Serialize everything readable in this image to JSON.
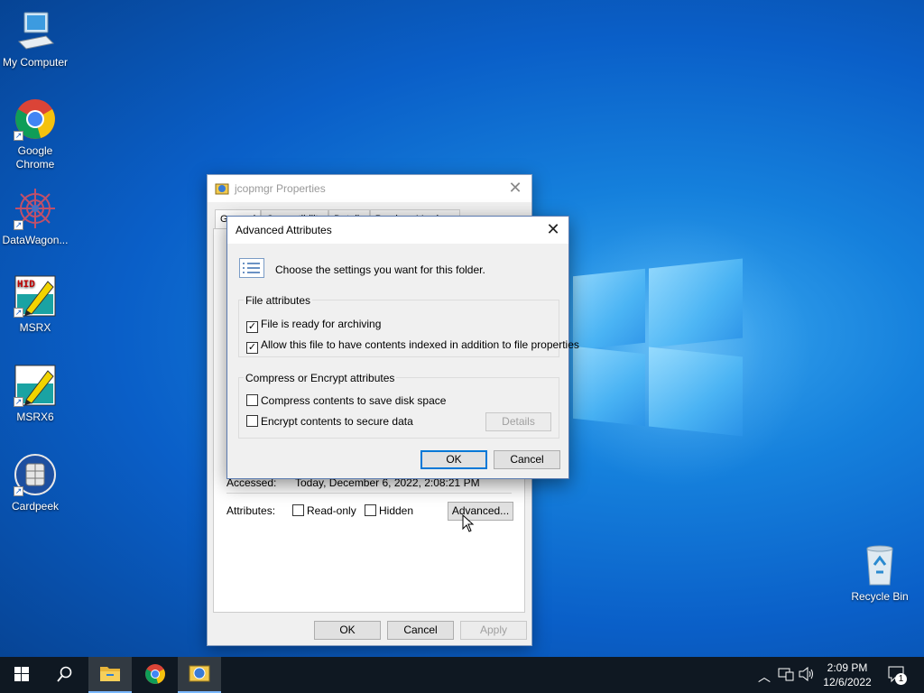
{
  "desktop": {
    "icons": [
      {
        "label": "My Computer",
        "icon": "computer-icon"
      },
      {
        "label": "Google Chrome",
        "icon": "chrome-icon"
      },
      {
        "label": "DataWagon...",
        "icon": "datawagon-icon"
      },
      {
        "label": "MSRX",
        "icon": "msrx-icon",
        "badge": "HID"
      },
      {
        "label": "MSRX6",
        "icon": "msrx6-icon"
      },
      {
        "label": "Cardpeek",
        "icon": "cardpeek-icon"
      },
      {
        "label": "Recycle Bin",
        "icon": "recycle-bin-icon"
      }
    ]
  },
  "properties_window": {
    "title": "jcopmgr Properties",
    "tabs": [
      "General",
      "Compatibility",
      "Details",
      "Previous Versions"
    ],
    "accessed_label": "Accessed:",
    "accessed_value": "Today, December 6, 2022, 2:08:21 PM",
    "attributes_label": "Attributes:",
    "readonly_label": "Read-only",
    "readonly_checked": false,
    "hidden_label": "Hidden",
    "hidden_checked": false,
    "advanced_button": "Advanced...",
    "ok_button": "OK",
    "cancel_button": "Cancel",
    "apply_button": "Apply"
  },
  "advanced_dialog": {
    "title": "Advanced Attributes",
    "intro": "Choose the settings you want for this folder.",
    "file_attributes_group": "File attributes",
    "archive_label": "File is ready for archiving",
    "archive_checked": true,
    "index_label": "Allow this file to have contents indexed in addition to file properties",
    "index_checked": true,
    "compress_group": "Compress or Encrypt attributes",
    "compress_label": "Compress contents to save disk space",
    "compress_checked": false,
    "encrypt_label": "Encrypt contents to secure data",
    "encrypt_checked": false,
    "details_button": "Details",
    "ok_button": "OK",
    "cancel_button": "Cancel"
  },
  "taskbar": {
    "time": "2:09 PM",
    "date": "12/6/2022",
    "notification_count": "1",
    "items": [
      "start-icon",
      "search-icon",
      "file-explorer-icon",
      "chrome-icon",
      "jcopmgr-icon"
    ]
  },
  "colors": {
    "accent": "#0078d7",
    "taskbar": "#0f1822",
    "wallpaper": "#0a5fc8"
  }
}
